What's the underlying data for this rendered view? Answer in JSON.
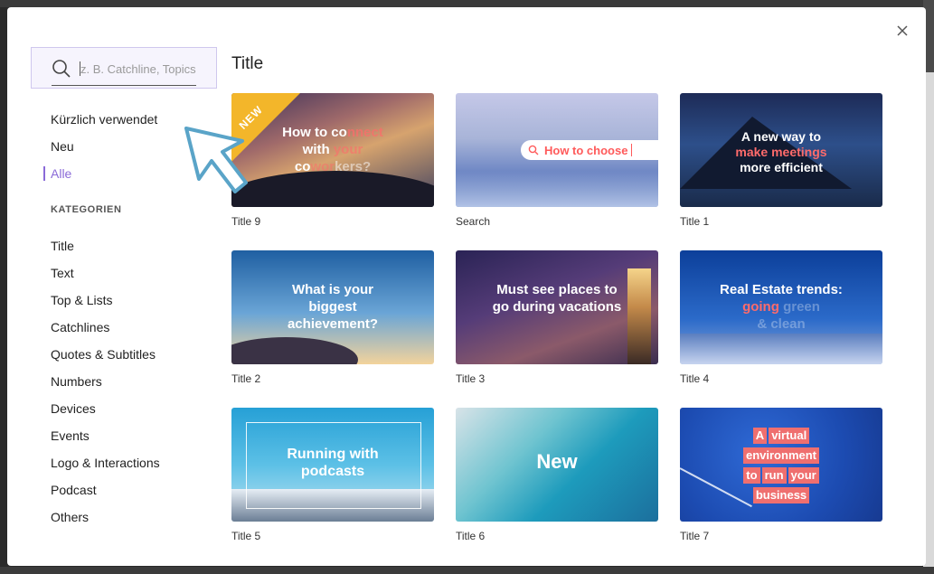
{
  "search": {
    "placeholder": "z. B. Catchline, Topics"
  },
  "nav": {
    "items": [
      {
        "label": "Kürzlich verwendet",
        "active": false
      },
      {
        "label": "Neu",
        "active": false
      },
      {
        "label": "Alle",
        "active": true
      }
    ]
  },
  "categories": {
    "heading": "KATEGORIEN",
    "items": [
      "Title",
      "Text",
      "Top & Lists",
      "Catchlines",
      "Quotes & Subtitles",
      "Numbers",
      "Devices",
      "Events",
      "Logo & Interactions",
      "Podcast",
      "Others"
    ]
  },
  "main": {
    "title": "Title",
    "cards": [
      {
        "label": "Title 9",
        "badge": "NEW",
        "headline_parts": [
          "How to co",
          "nnect",
          " with",
          " your",
          " co",
          "wor",
          "kers?"
        ]
      },
      {
        "label": "Search",
        "search_text": "How to choose"
      },
      {
        "label": "Title 1",
        "line1": "A new way to",
        "line2": "make meetings",
        "line3": "more efficient"
      },
      {
        "label": "Title 2",
        "headline": "What is your biggest achievement?"
      },
      {
        "label": "Title 3",
        "headline": "Must see places to go during vacations"
      },
      {
        "label": "Title 4",
        "line1": "Real Estate trends:",
        "line2a": "going",
        "line2b": "green",
        "line3": "& clean"
      },
      {
        "label": "Title 5",
        "headline": "Running with podcasts"
      },
      {
        "label": "Title 6",
        "headline": "New"
      },
      {
        "label": "Title 7",
        "words": [
          "A",
          "virtual",
          "environment",
          "to",
          "run",
          "your",
          "business"
        ]
      }
    ]
  },
  "colors": {
    "accent": "#8a6ad8",
    "highlight": "#ff6b6b",
    "badge": "#f3b62a"
  },
  "icons": {
    "close": "close-icon",
    "search": "search-icon",
    "cursor": "cursor-arrow-icon"
  }
}
